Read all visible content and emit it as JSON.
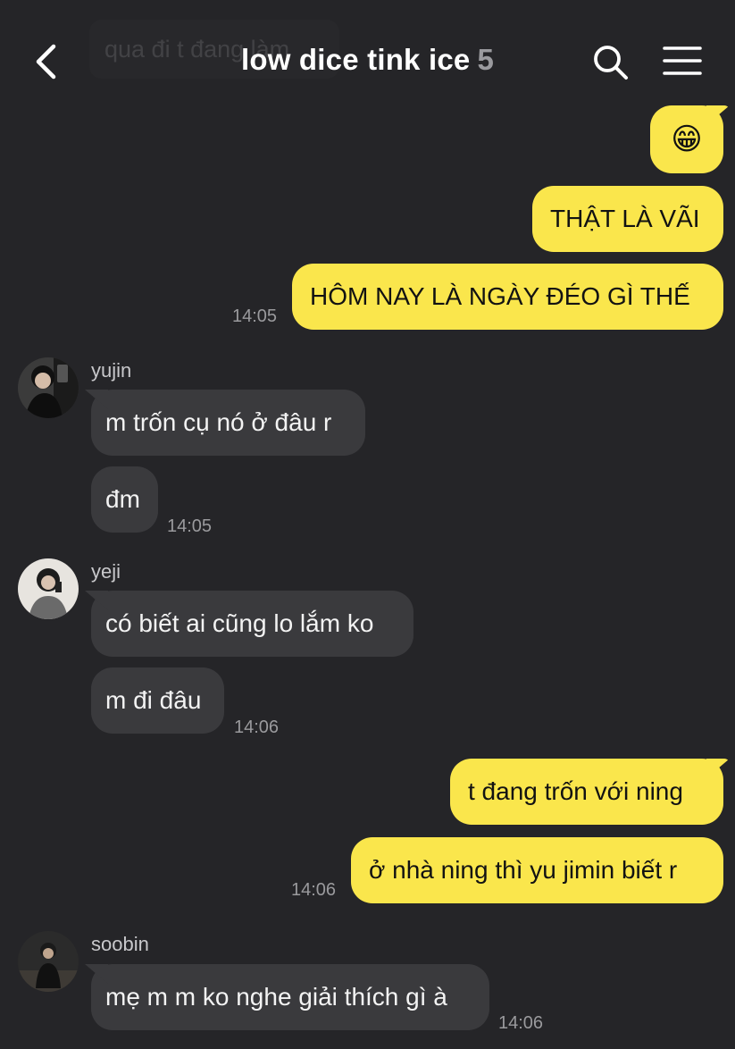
{
  "header": {
    "ghost_message": "qua đi t đang làm",
    "title": "low dice tink ice",
    "member_count": "5"
  },
  "messages": {
    "out_emoji": "😁",
    "out_1": "THẬT LÀ VÃI",
    "out_2": "HÔM NAY LÀ NGÀY ĐÉO GÌ THẾ",
    "out_2_time": "14:05",
    "yujin_name": "yujin",
    "yujin_1": "m trốn cụ nó ở đâu r",
    "yujin_2": "đm",
    "yujin_2_time": "14:05",
    "yeji_name": "yeji",
    "yeji_1": "có biết ai cũng lo lắm ko",
    "yeji_2": "m đi đâu",
    "yeji_2_time": "14:06",
    "out_3": "t đang trốn với ning",
    "out_4": "ở nhà ning thì yu jimin biết r",
    "out_4_time": "14:06",
    "soobin_name": "soobin",
    "soobin_1": "mẹ m m ko nghe giải thích gì à",
    "soobin_1_time": "14:06"
  },
  "colors": {
    "background": "#252528",
    "outgoing_bubble": "#fae64c",
    "incoming_bubble": "#3a3a3d"
  },
  "icons": {
    "back": "chevron-left-icon",
    "search": "search-icon",
    "menu": "hamburger-menu-icon"
  }
}
